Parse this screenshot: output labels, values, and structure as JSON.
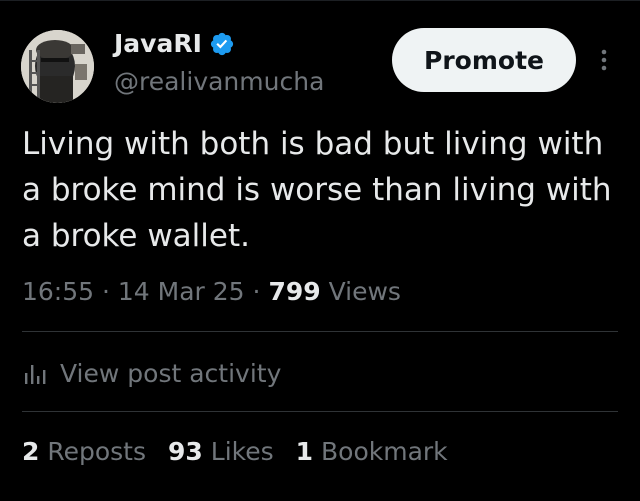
{
  "colors": {
    "background": "#000000",
    "primary_text": "#e7e9ea",
    "secondary_text": "#71767b",
    "divider": "#2f3336",
    "verified_badge": "#1d9bf0",
    "promote_button_bg": "#eff3f4"
  },
  "author": {
    "name": "JavaRI",
    "handle": "@realivanmucha",
    "verified_icon": "verified-badge-icon",
    "avatar_icon": "avatar-image"
  },
  "actions": {
    "promote_label": "Promote",
    "more_icon": "more-vertical-icon"
  },
  "post": {
    "text": "Living with both is bad but living with a broke mind is worse than living with a broke wallet.",
    "time": "16:55",
    "separator": "·",
    "date": "14 Mar 25",
    "views_count": "799",
    "views_label": "Views"
  },
  "activity": {
    "icon": "analytics-icon",
    "label": "View post activity"
  },
  "stats": {
    "reposts_count": "2",
    "reposts_label": "Reposts",
    "likes_count": "93",
    "likes_label": "Likes",
    "bookmarks_count": "1",
    "bookmarks_label": "Bookmark"
  }
}
